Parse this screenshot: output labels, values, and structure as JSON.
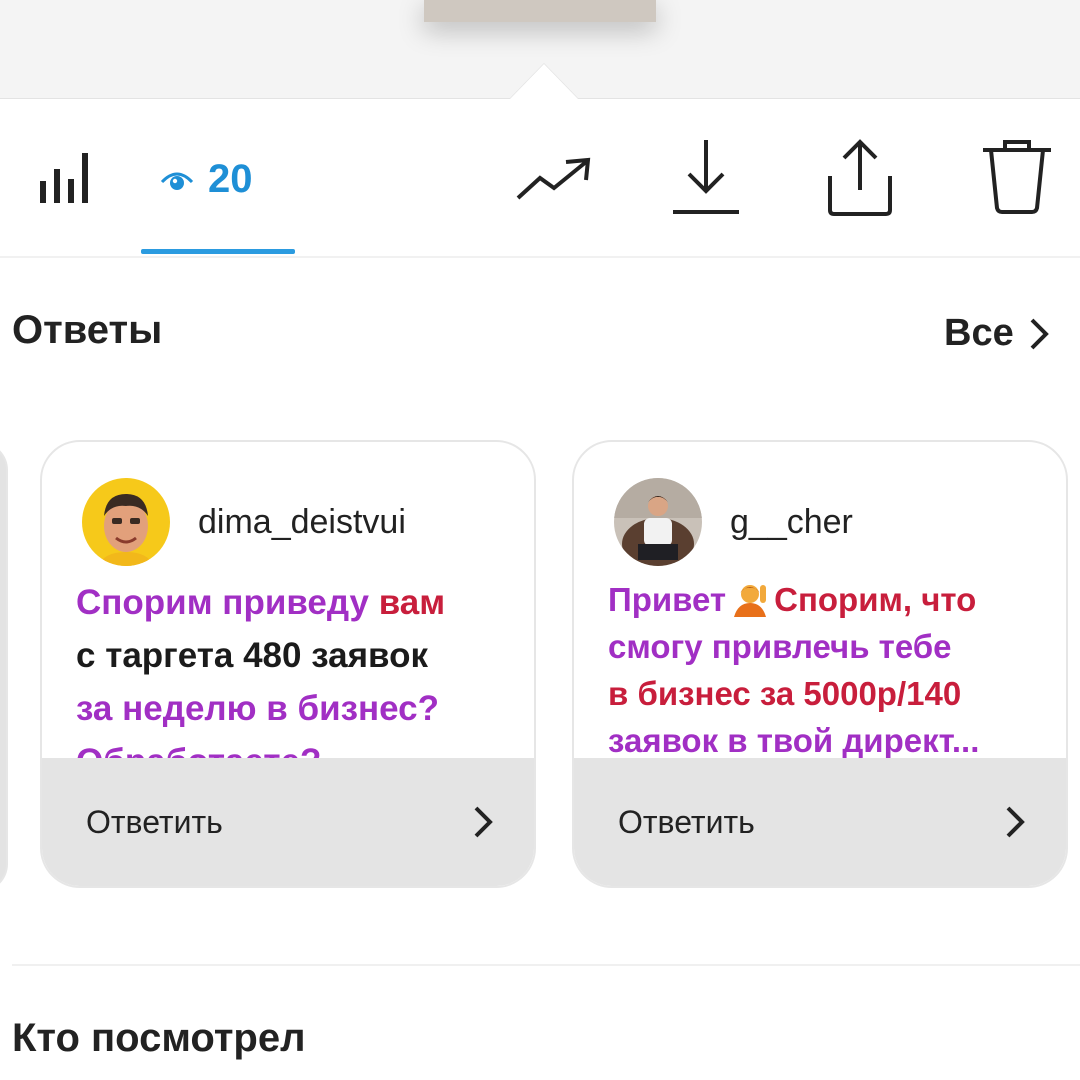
{
  "toolbar": {
    "views_count": "20",
    "icons": [
      "bar-chart-icon",
      "eye-icon",
      "trending-icon",
      "download-icon",
      "share-icon",
      "trash-icon"
    ],
    "accent_color": "#1e8fd6"
  },
  "replies": {
    "title": "Ответы",
    "see_all_label": "Все",
    "cards": [
      {
        "username": "dima_deistvui",
        "text_parts": [
          "Спорим приведу ",
          "вам",
          "с таргета 480 заявок",
          "за неделю в бизнес?",
          "Обработаете?"
        ],
        "reply_label": "Ответить"
      },
      {
        "username": "g__cher",
        "text_parts": [
          "Привет",
          "Спорим, что",
          "смогу привлечь тебе",
          "в бизнес за 5000р/140",
          "заявок в твой директ..."
        ],
        "reply_label": "Ответить"
      }
    ]
  },
  "viewers": {
    "title": "Кто посмотрел"
  }
}
